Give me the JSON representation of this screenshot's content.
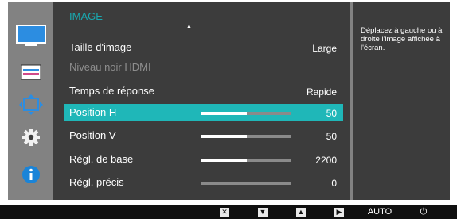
{
  "osd": {
    "menu_title": "IMAGE",
    "rows": [
      {
        "label": "Taille d'image",
        "value": "Large",
        "state": "normal",
        "bar": null
      },
      {
        "label": "Niveau noir HDMI",
        "value": "",
        "state": "disabled",
        "bar": null
      },
      {
        "label": "Temps de réponse",
        "value": "Rapide",
        "state": "normal",
        "bar": null
      },
      {
        "label": "Position H",
        "value": "50",
        "state": "selected",
        "bar": 0.5
      },
      {
        "label": "Position V",
        "value": "50",
        "state": "normal",
        "bar": 0.5
      },
      {
        "label": "Régl. de base",
        "value": "2200",
        "state": "normal",
        "bar": 0.5
      },
      {
        "label": "Régl. précis",
        "value": "0",
        "state": "normal",
        "bar": 0
      }
    ]
  },
  "help_text": "Déplacez à gauche ou à droite l'image affichée à l'écran.",
  "sidebar_icons": [
    "monitor-picture-icon",
    "color-bars-icon",
    "resize-arrows-icon",
    "gear-icon",
    "info-icon"
  ],
  "footer": {
    "keys": [
      {
        "name": "close-key-icon",
        "glyph": "✕"
      },
      {
        "name": "down-key-icon",
        "glyph": "▼"
      },
      {
        "name": "up-key-icon",
        "glyph": "▲"
      },
      {
        "name": "enter-key-icon",
        "glyph": "▶"
      }
    ],
    "auto_label": "AUTO",
    "power_glyph": "⏻"
  },
  "colors": {
    "accent": "#1fb7b8",
    "title": "#19a9b0",
    "panel": "#3c3c3c",
    "frame": "#828282"
  }
}
